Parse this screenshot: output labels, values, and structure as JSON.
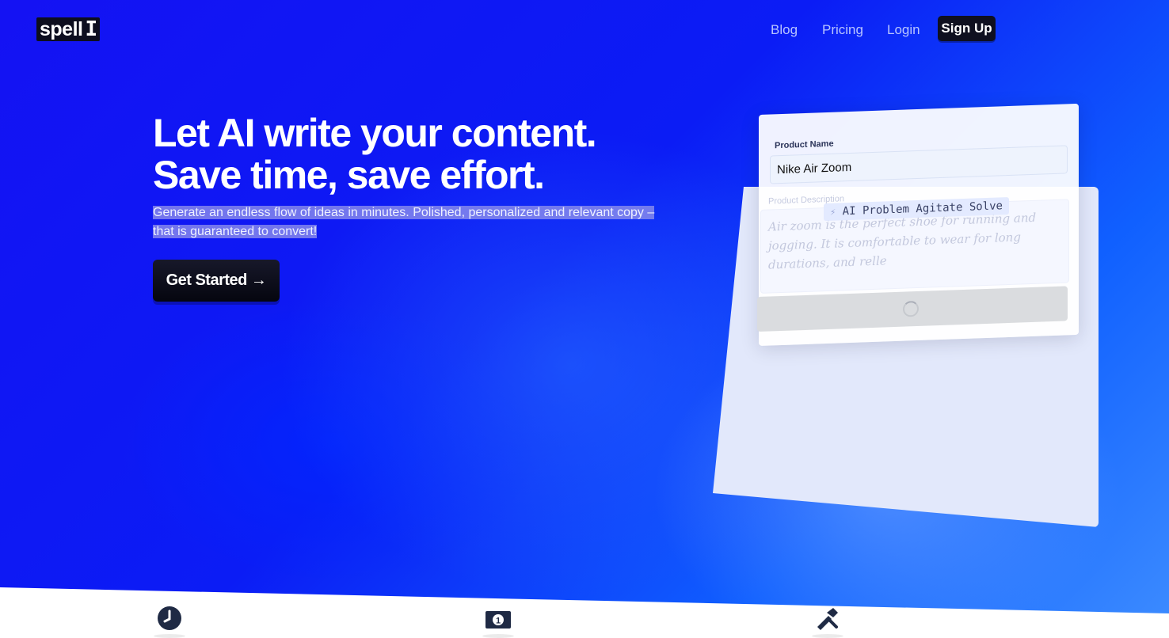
{
  "header": {
    "logo_text": "spell",
    "logo_cursor": "I",
    "nav": [
      "Blog",
      "Pricing",
      "Login"
    ],
    "signup_label": "Sign Up"
  },
  "hero": {
    "headline": "Let AI write your content. Save time, save effort.",
    "subcopy_line1": "Generate an endless flow of ideas in minutes. Polished, personalized and relevant copy –",
    "subcopy_line2": "that is guaranteed to convert!",
    "cta_label": "Get Started →"
  },
  "demo_card": {
    "product_name_label": "Product Name",
    "product_name_value": "Nike Air Zoom",
    "description_label": "Product Description",
    "framework_tag": "AI Problem Agitate Solve",
    "description_text": "Air zoom is the perfect shoe for running and jogging. It is comfortable to wear for long durations, and relle"
  },
  "features": {
    "icons": [
      "clock-icon",
      "money-icon",
      "tools-icon"
    ]
  },
  "colors": {
    "hero_blue": "#0b1cf5",
    "button_dark": "#0f1020",
    "nav_text": "#b8c4ff"
  }
}
